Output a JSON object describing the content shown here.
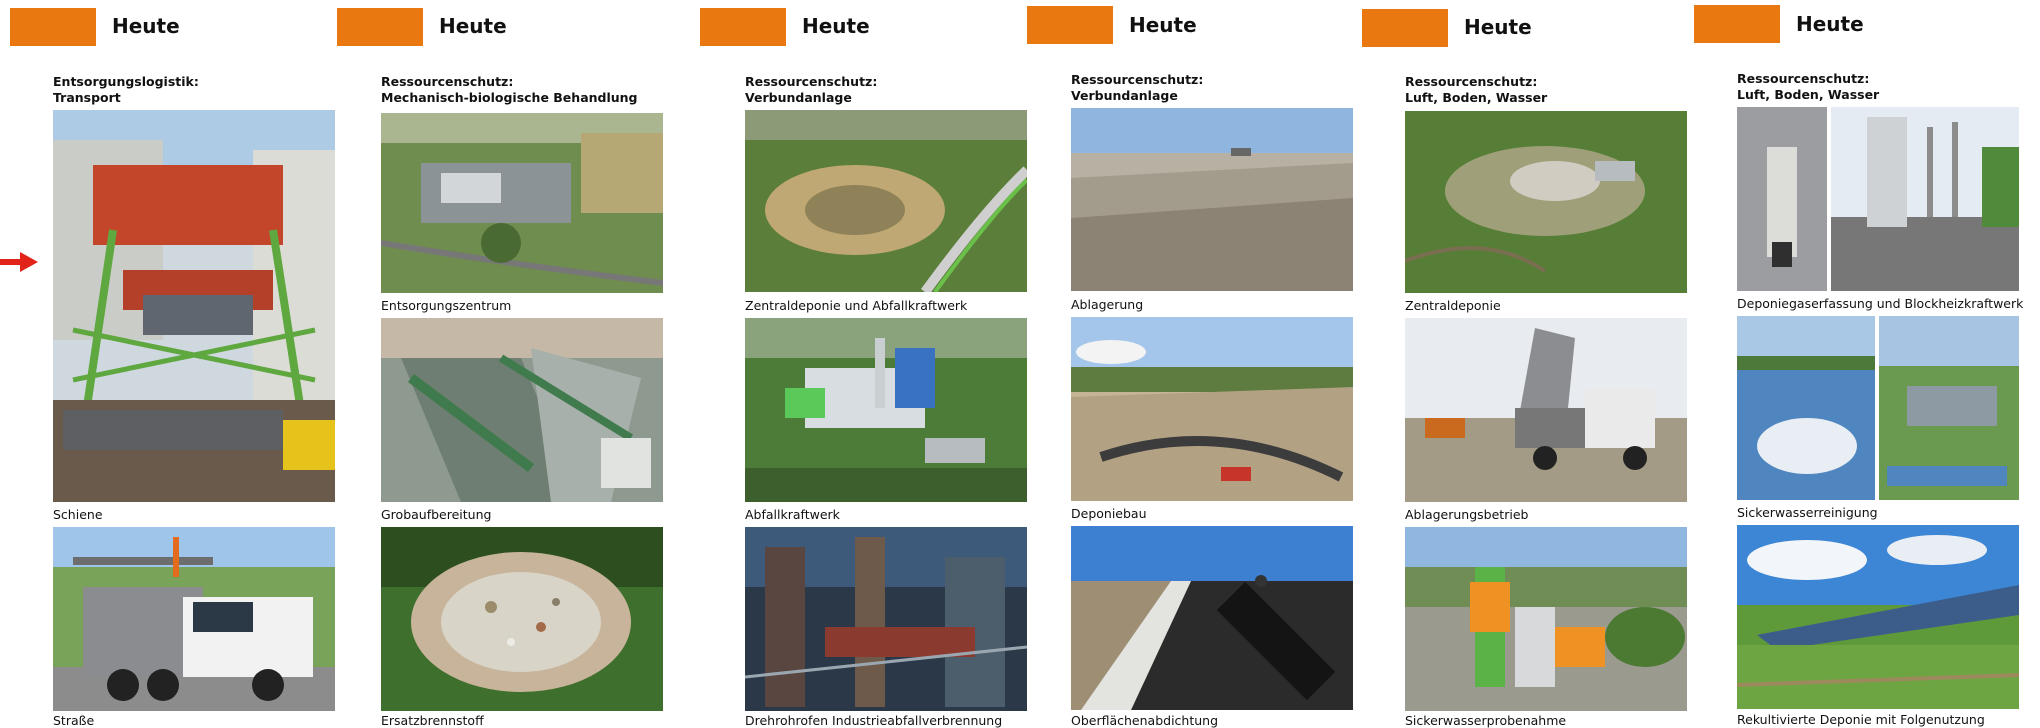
{
  "panels": [
    {
      "header": "Heute",
      "section": [
        "Entsorgungslogistik:",
        "Transport"
      ],
      "captions": [
        "Schiene",
        "Straße"
      ]
    },
    {
      "header": "Heute",
      "section": [
        "Ressourcenschutz:",
        "Mechanisch-biologische Behandlung"
      ],
      "captions": [
        "Entsorgungszentrum",
        "Grobaufbereitung",
        "Ersatzbrennstoff"
      ]
    },
    {
      "header": "Heute",
      "section": [
        "Ressourcenschutz:",
        "Verbundanlage"
      ],
      "captions": [
        "Zentraldeponie und Abfallkraftwerk",
        "Abfallkraftwerk",
        "Drehrohrofen Industrieabfallverbrennung"
      ]
    },
    {
      "header": "Heute",
      "section": [
        "Ressourcenschutz:",
        "Verbundanlage"
      ],
      "captions": [
        "Ablagerung",
        "Deponiebau",
        "Oberflächenabdichtung"
      ]
    },
    {
      "header": "Heute",
      "section": [
        "Ressourcenschutz:",
        "Luft, Boden, Wasser"
      ],
      "captions": [
        "Zentraldeponie",
        "Ablagerungsbetrieb",
        "Sickerwasserprobenahme"
      ]
    },
    {
      "header": "Heute",
      "section": [
        "Ressourcenschutz:",
        "Luft, Boden, Wasser"
      ],
      "captions": [
        "Deponiegaserfassung und Blockheizkraftwerk",
        "Sickerwasserreinigung",
        "Rekultivierte Deponie mit Folgenutzung"
      ]
    }
  ],
  "icons": {
    "pointer": "right-arrow-icon"
  },
  "colors": {
    "accent": "#e8780f",
    "arrow": "#e2231a"
  }
}
